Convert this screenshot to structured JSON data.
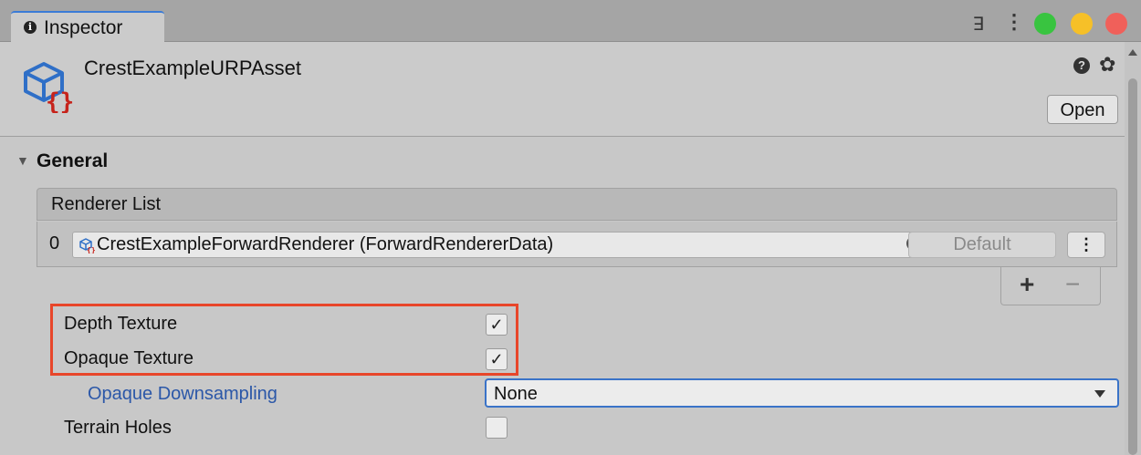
{
  "window": {
    "tab_label": "Inspector"
  },
  "header": {
    "asset_title": "CrestExampleURPAsset",
    "help_glyph": "?",
    "open_label": "Open"
  },
  "general": {
    "section_label": "General",
    "renderer_list": {
      "title": "Renderer List",
      "items": [
        {
          "index": "0",
          "name": "CrestExampleForwardRenderer (ForwardRendererData)",
          "default_label": "Default"
        }
      ],
      "add_glyph": "+",
      "remove_glyph": "−"
    },
    "properties": {
      "depth_texture": {
        "label": "Depth Texture",
        "checked": true
      },
      "opaque_texture": {
        "label": "Opaque Texture",
        "checked": true
      },
      "opaque_downsampling": {
        "label": "Opaque Downsampling",
        "value": "None"
      },
      "terrain_holes": {
        "label": "Terrain Holes",
        "checked": false
      }
    }
  },
  "icons": {
    "tab": "info-icon",
    "lock": "lock-icon",
    "menu": "kebab-icon",
    "asset": "scriptable-object-icon",
    "help": "help-icon",
    "settings": "gear-icon",
    "object_picker": "object-picker-icon"
  },
  "colors": {
    "tab_accent": "#3b7bd6",
    "highlight": "#e8462a",
    "overridden_label": "#2b57a8",
    "traffic_green": "#39c440",
    "traffic_yellow": "#f6c028",
    "traffic_red": "#f0605a"
  }
}
